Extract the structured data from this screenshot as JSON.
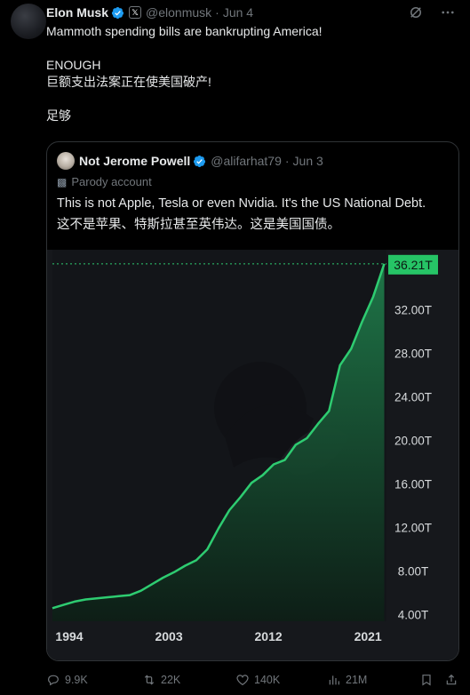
{
  "tweet": {
    "author_name": "Elon Musk",
    "handle": "@elonmusk",
    "separator": "·",
    "date": "Jun 4",
    "lines": [
      "Mammoth spending bills are bankrupting America!",
      "ENOUGH",
      "巨额支出法案正在使美国破产!",
      "足够"
    ],
    "affiliate_badge": "𝕏"
  },
  "quote": {
    "author_name": "Not Jerome Powell",
    "handle": "@alifarhat79",
    "separator": "·",
    "date": "Jun 3",
    "parody_label": "Parody account",
    "text_en": "This is not Apple, Tesla or even Nvidia. It's the US National Debt.",
    "text_zh": "这不是苹果、特斯拉甚至英伟达。这是美国国债。"
  },
  "chart_data": {
    "type": "area",
    "x": [
      1994,
      1995,
      1996,
      1997,
      1998,
      1999,
      2000,
      2001,
      2002,
      2003,
      2004,
      2005,
      2006,
      2007,
      2008,
      2009,
      2010,
      2011,
      2012,
      2013,
      2014,
      2015,
      2016,
      2017,
      2018,
      2019,
      2020,
      2021,
      2022,
      2023,
      2024
    ],
    "series": [
      {
        "values": [
          4.6,
          4.9,
          5.2,
          5.4,
          5.5,
          5.6,
          5.7,
          5.8,
          6.2,
          6.8,
          7.4,
          7.9,
          8.5,
          9.0,
          10.0,
          11.9,
          13.6,
          14.8,
          16.1,
          16.8,
          17.8,
          18.2,
          19.6,
          20.2,
          21.5,
          22.7,
          26.9,
          28.4,
          30.9,
          33.2,
          36.21
        ]
      }
    ],
    "last_value_label": "36.21T",
    "y_ticks": [
      "32.00T",
      "28.00T",
      "24.00T",
      "20.00T",
      "16.00T",
      "12.00T",
      "8.00T",
      "4.00T"
    ],
    "y_tick_values": [
      32,
      28,
      24,
      20,
      16,
      12,
      8,
      4
    ],
    "x_ticks": [
      "1994",
      "2003",
      "2012",
      "2021"
    ],
    "x_tick_values": [
      1994,
      2003,
      2012,
      2021
    ],
    "ylim": [
      3.4,
      37.5
    ],
    "xlim": [
      1994,
      2024.2
    ],
    "colors": {
      "line": "#2ecc71",
      "label_bg": "#26c466",
      "area_top": "#1f7a4a",
      "area_bottom": "#0d1f16"
    }
  },
  "actions": {
    "replies": "9.9K",
    "retweets": "22K",
    "likes": "140K",
    "views": "21M"
  }
}
